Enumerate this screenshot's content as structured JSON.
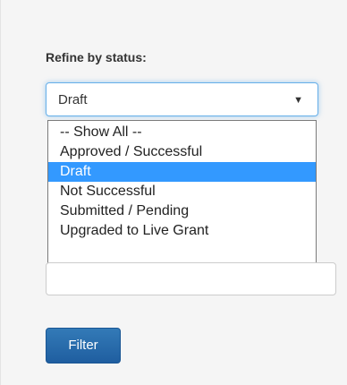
{
  "filter_panel": {
    "label": "Refine by status:",
    "status_select": {
      "value": "Draft",
      "arrow_icon": "caret-down-icon",
      "options": [
        "-- Show All --",
        "Approved / Successful",
        "Draft",
        "Not Successful",
        "Submitted / Pending",
        "Upgraded to Live Grant"
      ],
      "highlighted_option": "Draft"
    },
    "text_input_value": "",
    "filter_button_label": "Filter"
  },
  "colors": {
    "panel_background": "#f5f5f5",
    "option_highlight": "#3399ff",
    "button_primary": "#337ab7",
    "focus_border": "#66afe9"
  }
}
